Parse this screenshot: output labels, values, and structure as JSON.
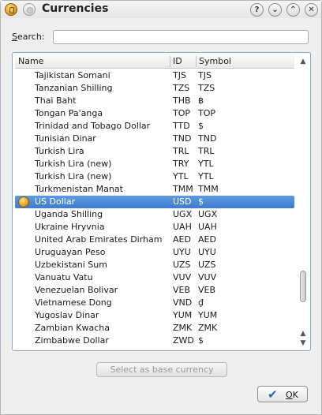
{
  "window": {
    "title": "Currencies",
    "buttons": {
      "help": "?",
      "minimize": "⌄",
      "maximize": "⌃",
      "close": "✕"
    }
  },
  "search": {
    "label_underlined": "S",
    "label_rest": "earch:",
    "value": "",
    "placeholder": ""
  },
  "list": {
    "columns": [
      "Name",
      "ID",
      "Symbol"
    ],
    "rows": [
      {
        "name": "Tajikistan Somani",
        "id": "TJS",
        "symbol": "TJS",
        "selected": false
      },
      {
        "name": "Tanzanian Shilling",
        "id": "TZS",
        "symbol": "TZS",
        "selected": false
      },
      {
        "name": "Thai Baht",
        "id": "THB",
        "symbol": "฿",
        "selected": false
      },
      {
        "name": "Tongan Pa'anga",
        "id": "TOP",
        "symbol": "TOP",
        "selected": false
      },
      {
        "name": "Trinidad and Tobago Dollar",
        "id": "TTD",
        "symbol": "$",
        "selected": false
      },
      {
        "name": "Tunisian Dinar",
        "id": "TND",
        "symbol": "TND",
        "selected": false
      },
      {
        "name": "Turkish Lira",
        "id": "TRL",
        "symbol": "TRL",
        "selected": false
      },
      {
        "name": "Turkish Lira (new)",
        "id": "TRY",
        "symbol": "YTL",
        "selected": false
      },
      {
        "name": "Turkish Lira (new)",
        "id": "YTL",
        "symbol": "YTL",
        "selected": false
      },
      {
        "name": "Turkmenistan Manat",
        "id": "TMM",
        "symbol": "TMM",
        "selected": false
      },
      {
        "name": "US Dollar",
        "id": "USD",
        "symbol": "$",
        "selected": true
      },
      {
        "name": "Uganda Shilling",
        "id": "UGX",
        "symbol": "UGX",
        "selected": false
      },
      {
        "name": "Ukraine Hryvnia",
        "id": "UAH",
        "symbol": "UAH",
        "selected": false
      },
      {
        "name": "United Arab Emirates Dirham",
        "id": "AED",
        "symbol": "AED",
        "selected": false
      },
      {
        "name": "Uruguayan Peso",
        "id": "UYU",
        "symbol": "UYU",
        "selected": false
      },
      {
        "name": "Uzbekistani Sum",
        "id": "UZS",
        "symbol": "UZS",
        "selected": false
      },
      {
        "name": "Vanuatu Vatu",
        "id": "VUV",
        "symbol": "VUV",
        "selected": false
      },
      {
        "name": "Venezuelan Bolivar",
        "id": "VEB",
        "symbol": "VEB",
        "selected": false
      },
      {
        "name": "Vietnamese Dong",
        "id": "VND",
        "symbol": "₫",
        "selected": false
      },
      {
        "name": "Yugoslav Dinar",
        "id": "YUM",
        "symbol": "YUM",
        "selected": false
      },
      {
        "name": "Zambian Kwacha",
        "id": "ZMK",
        "symbol": "ZMK",
        "selected": false
      },
      {
        "name": "Zimbabwe Dollar",
        "id": "ZWD",
        "symbol": "$",
        "selected": false
      }
    ],
    "selected_icon": "coin-icon",
    "scroll_position": 0.88
  },
  "actions": {
    "base_currency_label": "Select as base currency",
    "base_currency_enabled": false,
    "ok_label_underlined": "O",
    "ok_label_rest": "K",
    "ok_icon": "checkmark-icon"
  },
  "colors": {
    "selection": "#4a89d8",
    "focus_border": "#8aa6c6",
    "ok_icon": "#2a62b5"
  }
}
